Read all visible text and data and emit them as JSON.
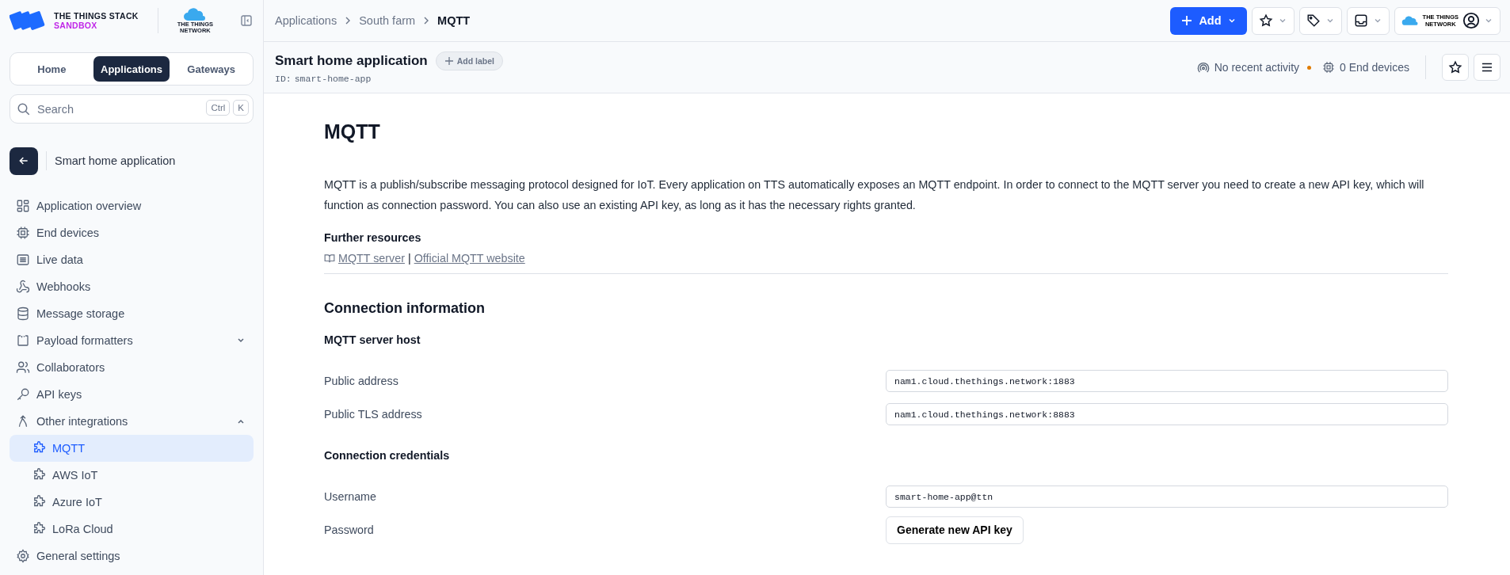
{
  "sidebar": {
    "brand": {
      "title": "THE THINGS STACK",
      "subtitle": "SANDBOX",
      "partner_lines": [
        "THE THINGS",
        "NETWORK"
      ]
    },
    "nav_tabs": [
      {
        "label": "Home",
        "selected": false
      },
      {
        "label": "Applications",
        "selected": true
      },
      {
        "label": "Gateways",
        "selected": false
      }
    ],
    "search": {
      "placeholder": "Search",
      "shortcut": [
        "Ctrl",
        "K"
      ]
    },
    "back_title": "Smart home application",
    "items": [
      {
        "label": "Application overview"
      },
      {
        "label": "End devices"
      },
      {
        "label": "Live data"
      },
      {
        "label": "Webhooks"
      },
      {
        "label": "Message storage"
      },
      {
        "label": "Payload formatters",
        "expanded": false
      },
      {
        "label": "Collaborators"
      },
      {
        "label": "API keys"
      },
      {
        "label": "Other integrations",
        "expanded": true,
        "children": [
          {
            "label": "MQTT",
            "selected": true
          },
          {
            "label": "AWS IoT",
            "selected": false
          },
          {
            "label": "Azure IoT",
            "selected": false
          },
          {
            "label": "LoRa Cloud",
            "selected": false
          }
        ]
      },
      {
        "label": "General settings"
      }
    ]
  },
  "topbar": {
    "breadcrumbs": [
      "Applications",
      "South farm",
      "MQTT"
    ],
    "add_button": "Add",
    "account_logo_lines": [
      "THE THINGS",
      "NETWORK"
    ]
  },
  "header": {
    "title": "Smart home application",
    "id_label": "ID:",
    "id": "smart-home-app",
    "add_label": "Add label",
    "activity": "No recent activity",
    "devices": "0 End devices"
  },
  "content": {
    "title": "MQTT",
    "description": "MQTT is a publish/subscribe messaging protocol designed for IoT. Every application on TTS automatically exposes an MQTT endpoint. In order to connect to the MQTT server you need to create a new API key, which will function as connection password. You can also use an existing API key, as long as it has the necessary rights granted.",
    "resources_title": "Further resources",
    "links": [
      "MQTT server",
      "Official MQTT website"
    ],
    "link_separator": "|",
    "section_title": "Connection information",
    "groups": [
      {
        "title": "MQTT server host",
        "fields": [
          {
            "kind": "text",
            "label": "Public address",
            "value": "nam1.cloud.thethings.network:1883"
          },
          {
            "kind": "text",
            "label": "Public TLS address",
            "value": "nam1.cloud.thethings.network:8883"
          }
        ]
      },
      {
        "title": "Connection credentials",
        "fields": [
          {
            "kind": "text",
            "label": "Username",
            "value": "smart-home-app@ttn"
          },
          {
            "kind": "button",
            "label": "Password",
            "value": "Generate new API key"
          }
        ]
      }
    ]
  }
}
